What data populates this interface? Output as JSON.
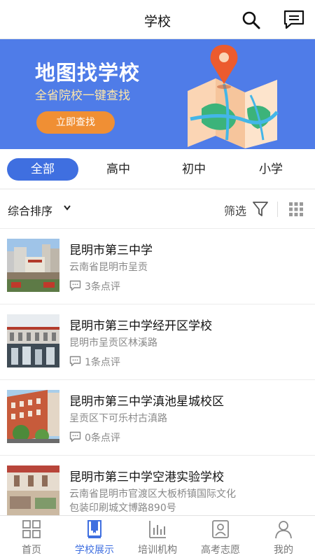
{
  "header": {
    "title": "学校",
    "search_icon": "search-icon",
    "message_icon": "message-icon"
  },
  "banner": {
    "headline": "地图找学校",
    "subline": "全省院校一键查找",
    "button_label": "立即查找",
    "illustration": "map-pin-illustration"
  },
  "tabs": [
    {
      "label": "全部",
      "active": true
    },
    {
      "label": "高中",
      "active": false
    },
    {
      "label": "初中",
      "active": false
    },
    {
      "label": "小学",
      "active": false
    }
  ],
  "sortbar": {
    "sort_label": "综合排序",
    "filter_label": "筛选",
    "filter_icon": "funnel-icon",
    "view_icon": "grid-view-icon"
  },
  "schools": [
    {
      "name": "昆明市第三中学",
      "address": "云南省昆明市呈贡",
      "reviews": "3条点评"
    },
    {
      "name": "昆明市第三中学经开区学校",
      "address": "昆明市呈贡区林溪路",
      "reviews": "1条点评"
    },
    {
      "name": "昆明市第三中学滇池星城校区",
      "address": "呈贡区下可乐村古滇路",
      "reviews": "0条点评"
    },
    {
      "name": "昆明市第三中学空港实验学校",
      "address": "云南省昆明市官渡区大板桥镇国际文化包装印刷城文博路890号",
      "reviews": ""
    }
  ],
  "nav": [
    {
      "label": "首页",
      "icon": "home-grid-icon",
      "active": false
    },
    {
      "label": "学校展示",
      "icon": "book-icon",
      "active": true
    },
    {
      "label": "培训机构",
      "icon": "training-chart-icon",
      "active": false
    },
    {
      "label": "高考志愿",
      "icon": "profile-card-icon",
      "active": false
    },
    {
      "label": "我的",
      "icon": "user-icon",
      "active": false
    }
  ],
  "colors": {
    "accent": "#3f6fe0",
    "banner_bg": "#4f7ce8",
    "button_orange": "#f08f34"
  }
}
